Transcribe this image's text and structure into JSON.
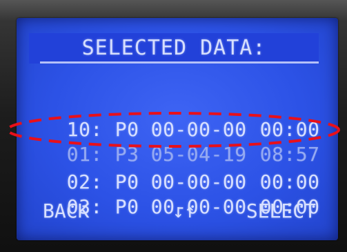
{
  "screen": {
    "title": "SELECTED DATA:",
    "records": [
      {
        "index": "10:",
        "program": "P0",
        "date": "00-00-00",
        "time": "00:00"
      },
      {
        "index": "01:",
        "program": "P3",
        "date": "05-04-19",
        "time": "08:57"
      },
      {
        "index": "02:",
        "program": "P0",
        "date": "00-00-00",
        "time": "00:00"
      },
      {
        "index": "03:",
        "program": "P0",
        "date": "00-00-00",
        "time": "00:00"
      }
    ]
  },
  "footer": {
    "back_label": "BACK",
    "nav_label": "↓↑",
    "select_label": "SELECT"
  },
  "colors": {
    "lcd_background": "#2c52e6",
    "lcd_text": "#d8e0ff",
    "highlight_text": "#96aaf2",
    "annotation": "#e8101a"
  }
}
